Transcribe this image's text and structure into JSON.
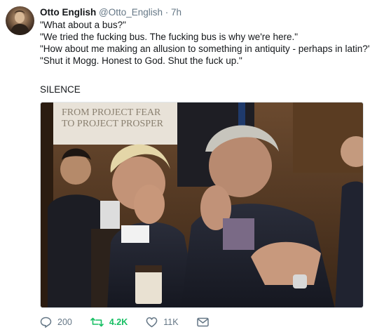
{
  "tweet": {
    "author_name": "Otto English",
    "author_handle": "@Otto_English",
    "separator": "·",
    "time": "7h",
    "lines": [
      "\"What about a bus?\"",
      "\"We tried the fucking bus. The fucking bus is why we're here.\"",
      "\"How about me making an allusion to something in antiquity - perhaps in latin?\"",
      "\"Shut it Mogg. Honest to God. Shut the fuck up.\""
    ],
    "closing": "SILENCE"
  },
  "photo": {
    "banner_line1": "FROM PROJECT FEAR",
    "banner_line2": "TO PROJECT PROSPER"
  },
  "actions": {
    "reply_count": "200",
    "retweet_count": "4.2K",
    "like_count": "11K"
  },
  "colors": {
    "retweet_active": "#17bf63",
    "muted": "#657786"
  }
}
